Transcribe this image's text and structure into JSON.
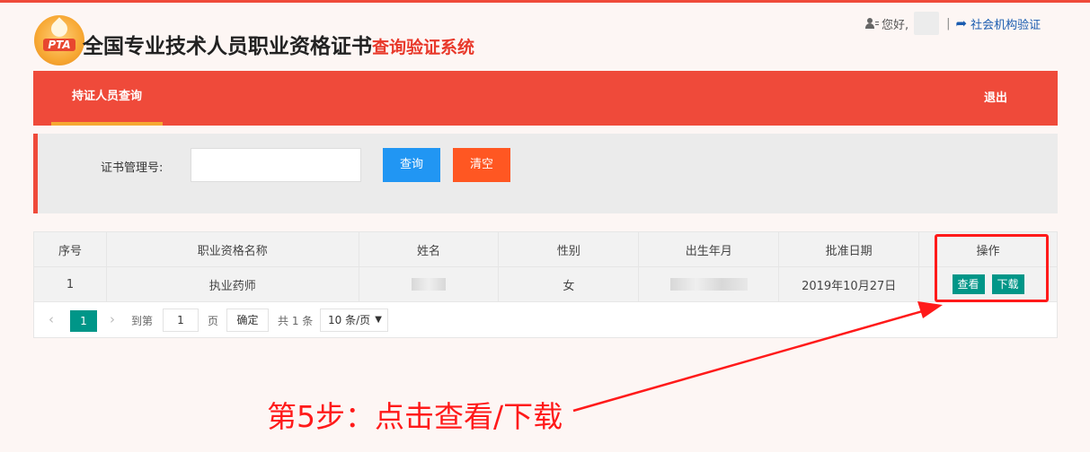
{
  "header": {
    "logo_text": "PTA",
    "title_main": "全国专业技术人员职业资格证书",
    "title_sub": "查询验证系统",
    "greeting": "您好,",
    "separator": "|",
    "social_link": "社会机构验证"
  },
  "nav": {
    "tab_active": "持证人员查询",
    "logout": "退出"
  },
  "search": {
    "label": "证书管理号:",
    "input_value": "",
    "query_button": "查询",
    "clear_button": "清空"
  },
  "table": {
    "columns": [
      "序号",
      "职业资格名称",
      "姓名",
      "性别",
      "出生年月",
      "批准日期",
      "操作"
    ],
    "rows": [
      {
        "index": "1",
        "qualification": "执业药师",
        "gender": "女",
        "approval_date": "2019年10月27日",
        "view": "查看",
        "download": "下载"
      }
    ]
  },
  "pager": {
    "prev": "‹",
    "current": "1",
    "next": "›",
    "goto_label": "到第",
    "goto_value": "1",
    "page_unit": "页",
    "confirm": "确定",
    "total": "共 1 条",
    "page_size": "10 条/页"
  },
  "annotation": {
    "text": "第5步：点击查看/下载",
    "color": "#ff1a1a"
  },
  "colors": {
    "brand_red": "#ef4a3a",
    "query_blue": "#2196f3",
    "clear_orange": "#ff5722",
    "action_teal": "#009688"
  }
}
